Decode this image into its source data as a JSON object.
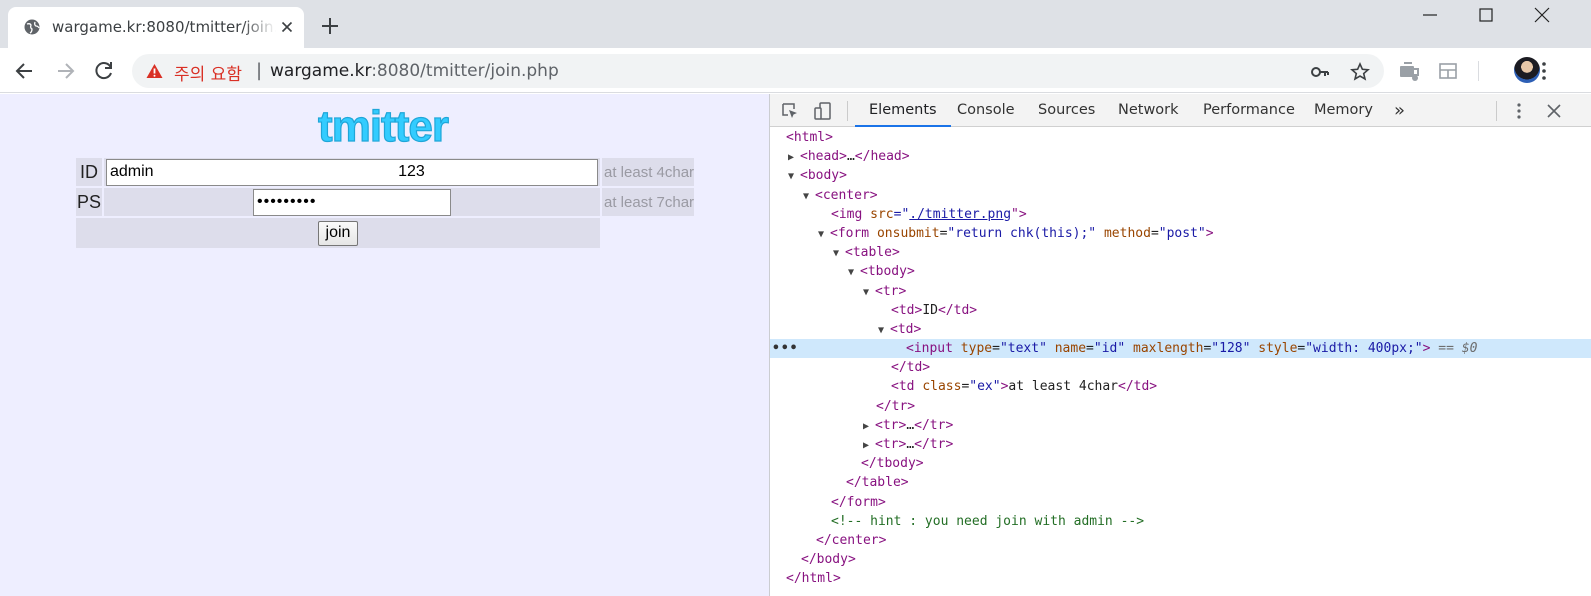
{
  "tab": {
    "title": "wargame.kr:8080/tmitter/join.php"
  },
  "omnibox": {
    "security_label": "주의 요함",
    "separator": "|",
    "url_host": "wargame.kr",
    "url_rest": ":8080/tmitter/join.php"
  },
  "page": {
    "logo_text": "tmitter",
    "id_label": "ID",
    "id_value": "admin                                                       123",
    "id_hint": "at least 4char",
    "ps_label": "PS",
    "ps_value": "•••••••••",
    "ps_hint": "at least 7char",
    "join_label": "join"
  },
  "devtools": {
    "tabs": [
      "Elements",
      "Console",
      "Sources",
      "Network",
      "Performance",
      "Memory"
    ],
    "overflow": "»",
    "lines": {
      "l0_tag": "<html>",
      "l1_open": "<head>",
      "l1_mid": "…",
      "l1_close": "</head>",
      "l2_tag": "<body>",
      "l3_tag": "<center>",
      "l4_open": "<img ",
      "l4_attr": "src",
      "l4_eq": "=\"",
      "l4_val": "./tmitter.png",
      "l4_end": "\">",
      "l5_open": "<form ",
      "l5_a1": "onsubmit",
      "l5_v1": "\"return chk(this);\"",
      "l5_a2": "method",
      "l5_v2": "\"post\"",
      "l5_end": ">",
      "l6_tag": "<table>",
      "l7_tag": "<tbody>",
      "l8_tag": "<tr>",
      "l9_open": "<td>",
      "l9_text": "ID",
      "l9_close": "</td>",
      "l10_tag": "<td>",
      "l11_open": "<input ",
      "l11_a1": "type",
      "l11_v1": "\"text\"",
      "l11_a2": "name",
      "l11_v2": "\"id\"",
      "l11_a3": "maxlength",
      "l11_v3": "\"128\"",
      "l11_a4": "style",
      "l11_v4": "\"width: 400px;\"",
      "l11_end": ">",
      "l11_ghost": " == $0",
      "l11_dots": "•••",
      "l12_tag": "</td>",
      "l13_open": "<td ",
      "l13_attr": "class",
      "l13_val": "\"ex\"",
      "l13_end": ">",
      "l13_text": "at least 4char",
      "l13_close": "</td>",
      "l14_tag": "</tr>",
      "l15_open": "<tr>",
      "l15_mid": "…",
      "l15_close": "</tr>",
      "l16_open": "<tr>",
      "l16_mid": "…",
      "l16_close": "</tr>",
      "l17_tag": "</tbody>",
      "l18_tag": "</table>",
      "l19_tag": "</form>",
      "l20_cmt": "<!-- hint : you need join with admin -->",
      "l21_tag": "</center>",
      "l22_tag": "</body>",
      "l23_tag": "</html>"
    }
  }
}
